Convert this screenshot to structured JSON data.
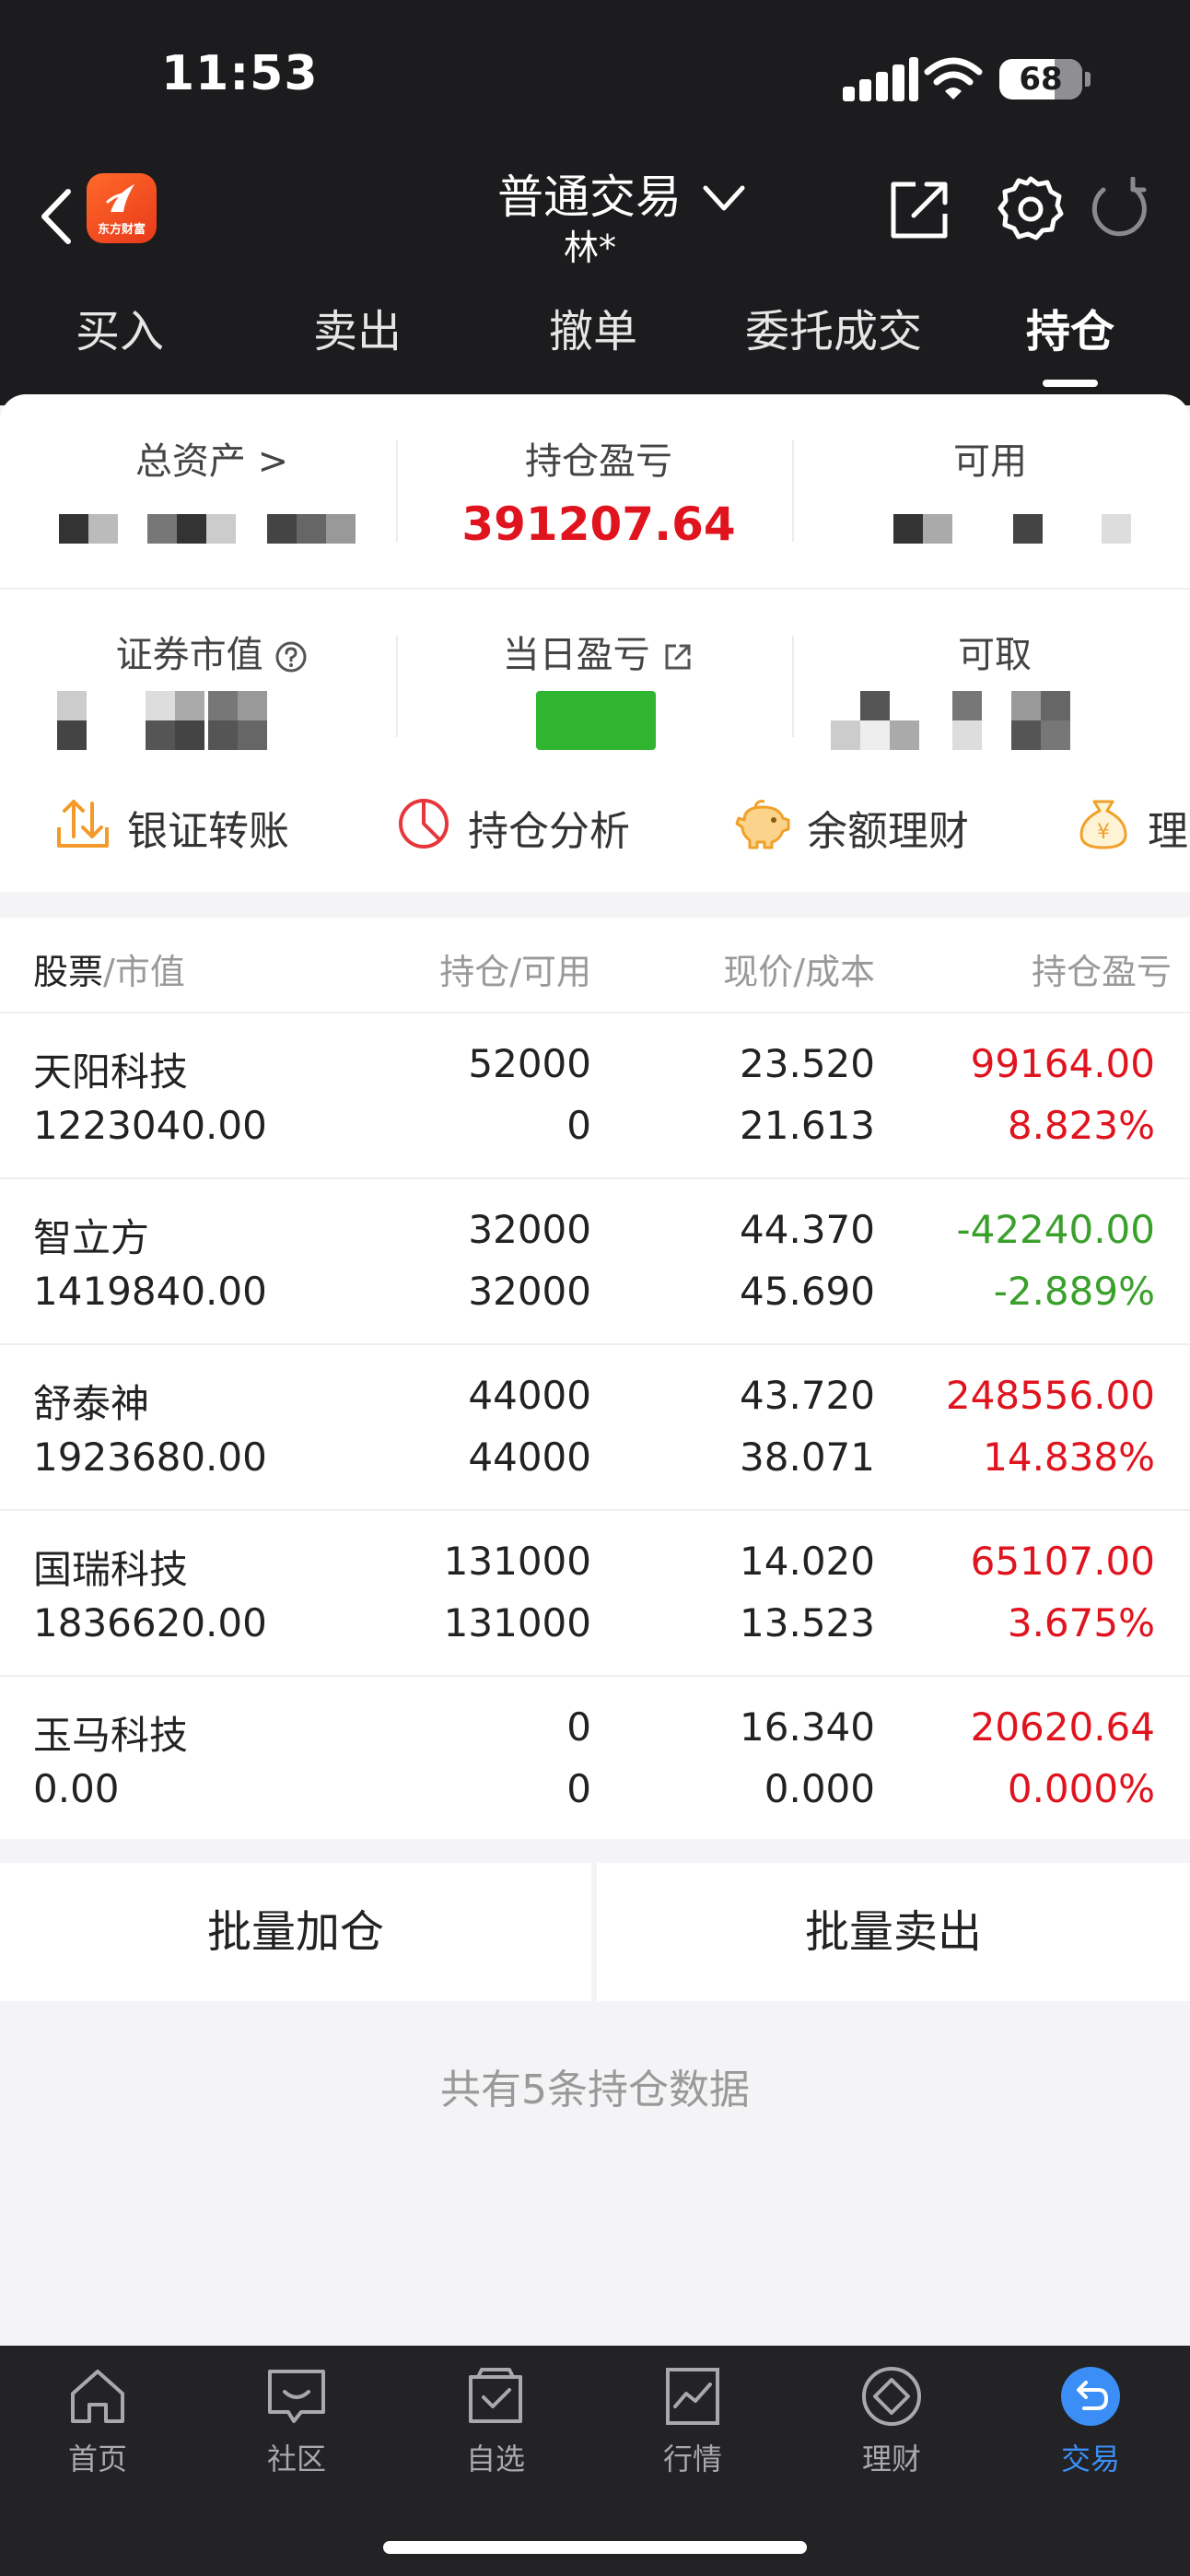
{
  "status_bar": {
    "time": "11:53",
    "battery": "68"
  },
  "nav": {
    "title": "普通交易",
    "subtitle": "林*"
  },
  "tabs": [
    "买入",
    "卖出",
    "撤单",
    "委托成交",
    "持仓"
  ],
  "account": {
    "total_assets_label": "总资产 >",
    "position_pnl_label": "持仓盈亏",
    "position_pnl_value": "391207.64",
    "available_label": "可用",
    "market_value_label": "证券市值",
    "daily_pnl_label": "当日盈亏",
    "withdrawable_label": "可取"
  },
  "quick_actions": [
    "银证转账",
    "持仓分析",
    "余额理财",
    "理财"
  ],
  "table": {
    "headers": {
      "stock": "股票",
      "market_value": "/市值",
      "position": "持仓/可用",
      "price": "现价/成本",
      "pnl": "持仓盈亏"
    },
    "rows": [
      {
        "name": "天阳科技",
        "market_value": "1223040.00",
        "position": "52000",
        "available": "0",
        "price": "23.520",
        "cost": "21.613",
        "pnl": "99164.00",
        "pnl_pct": "8.823%",
        "up": true
      },
      {
        "name": "智立方",
        "market_value": "1419840.00",
        "position": "32000",
        "available": "32000",
        "price": "44.370",
        "cost": "45.690",
        "pnl": "-42240.00",
        "pnl_pct": "-2.889%",
        "up": false
      },
      {
        "name": "舒泰神",
        "market_value": "1923680.00",
        "position": "44000",
        "available": "44000",
        "price": "43.720",
        "cost": "38.071",
        "pnl": "248556.00",
        "pnl_pct": "14.838%",
        "up": true
      },
      {
        "name": "国瑞科技",
        "market_value": "1836620.00",
        "position": "131000",
        "available": "131000",
        "price": "14.020",
        "cost": "13.523",
        "pnl": "65107.00",
        "pnl_pct": "3.675%",
        "up": true
      },
      {
        "name": "玉马科技",
        "market_value": "0.00",
        "position": "0",
        "available": "0",
        "price": "16.340",
        "cost": "0.000",
        "pnl": "20620.64",
        "pnl_pct": "0.000%",
        "up": true
      }
    ]
  },
  "batch": {
    "add": "批量加仓",
    "sell": "批量卖出"
  },
  "footer_note": "共有5条持仓数据",
  "tabbar": [
    "首页",
    "社区",
    "自选",
    "行情",
    "理财",
    "交易"
  ],
  "colors": {
    "up": "#e0141e",
    "down": "#3aa02c",
    "accent": "#3a8ef6",
    "dark": "#1c1c1e"
  },
  "icons": [
    "back-icon",
    "app-logo",
    "chevron-down-icon",
    "share-icon",
    "gear-icon",
    "refresh-icon",
    "help-icon",
    "external-link-icon",
    "transfer-icon",
    "pie-chart-icon",
    "piggy-bank-icon",
    "money-bag-icon",
    "home-icon",
    "community-icon",
    "watchlist-icon",
    "market-icon",
    "wealth-icon",
    "trade-icon"
  ]
}
